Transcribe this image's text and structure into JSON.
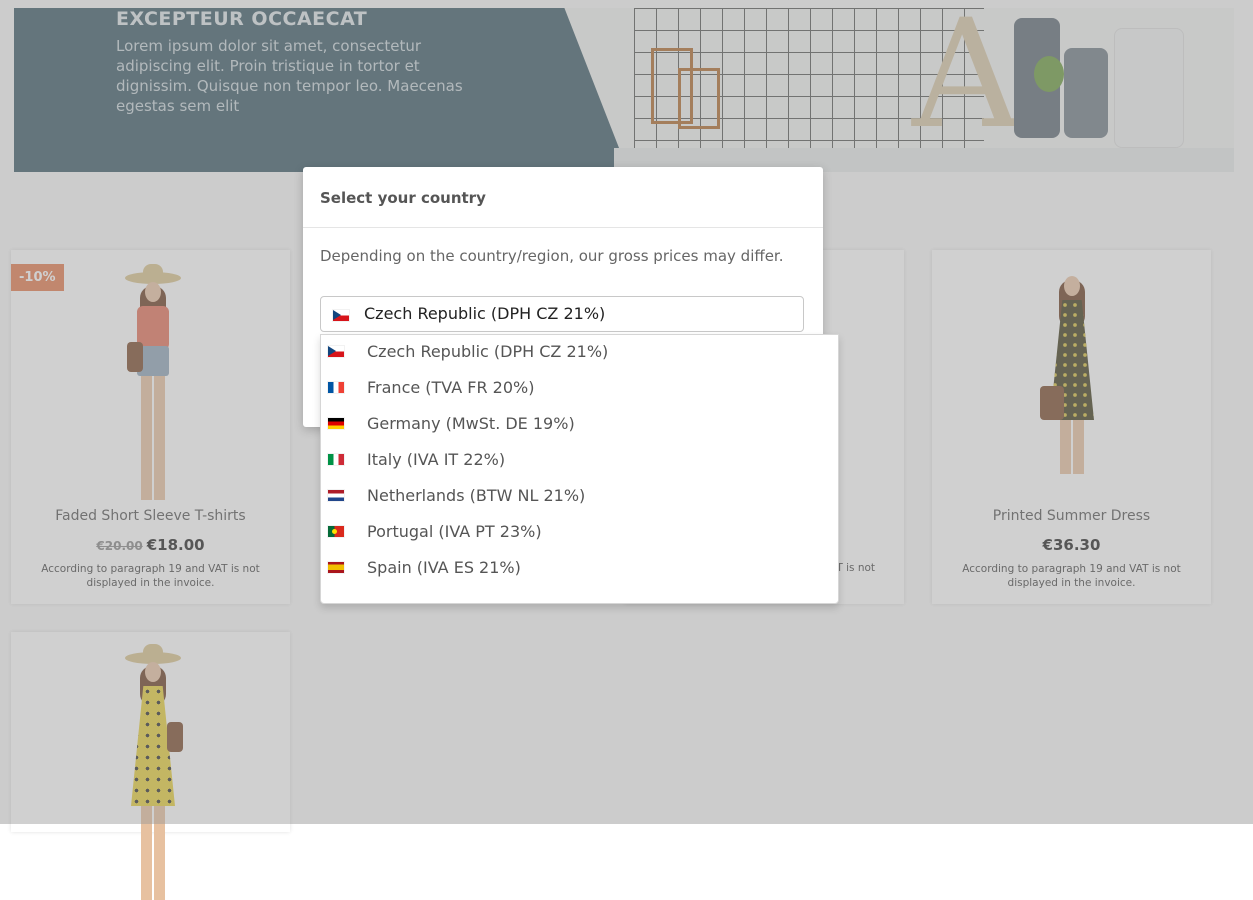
{
  "hero": {
    "heading": "EXCEPTEUR OCCAECAT",
    "text": "Lorem ipsum dolor sit amet, consectetur adipiscing elit. Proin tristique in tortor et dignissim. Quisque non tempor leo. Maecenas egestas sem elit",
    "art_letter": "A"
  },
  "products": [
    {
      "name": "Faded Short Sleeve T-shirts",
      "badge": "-10%",
      "old_price": "€20.00",
      "price": "€18.00",
      "note": "According to paragraph 19 and VAT is not displayed in the invoice."
    },
    {
      "name": "",
      "note_fragment": "AT is not"
    },
    {
      "name": "Printed Summer Dress",
      "price": "€36.30",
      "note": "According to paragraph 19 and VAT is not displayed in the invoice."
    }
  ],
  "modal": {
    "title": "Select your country",
    "description": "Depending on the country/region, our gross prices may differ.",
    "selected": {
      "label": "Czech Republic (DPH CZ 21%)",
      "flag_icon": "flag-cz-icon"
    },
    "options": [
      {
        "label": "Czech Republic (DPH CZ 21%)",
        "flag_icon": "flag-cz-icon"
      },
      {
        "label": "France (TVA FR 20%)",
        "flag_icon": "flag-fr-icon"
      },
      {
        "label": "Germany (MwSt. DE 19%)",
        "flag_icon": "flag-de-icon"
      },
      {
        "label": "Italy (IVA IT 22%)",
        "flag_icon": "flag-it-icon"
      },
      {
        "label": "Netherlands (BTW NL 21%)",
        "flag_icon": "flag-nl-icon"
      },
      {
        "label": "Portugal (IVA PT 23%)",
        "flag_icon": "flag-pt-icon"
      },
      {
        "label": "Spain (IVA ES 21%)",
        "flag_icon": "flag-es-icon"
      }
    ]
  },
  "colors": {
    "hero_panel": "#3b5966",
    "badge": "#e37b4d",
    "overlay": "rgba(150,150,150,.45)"
  }
}
